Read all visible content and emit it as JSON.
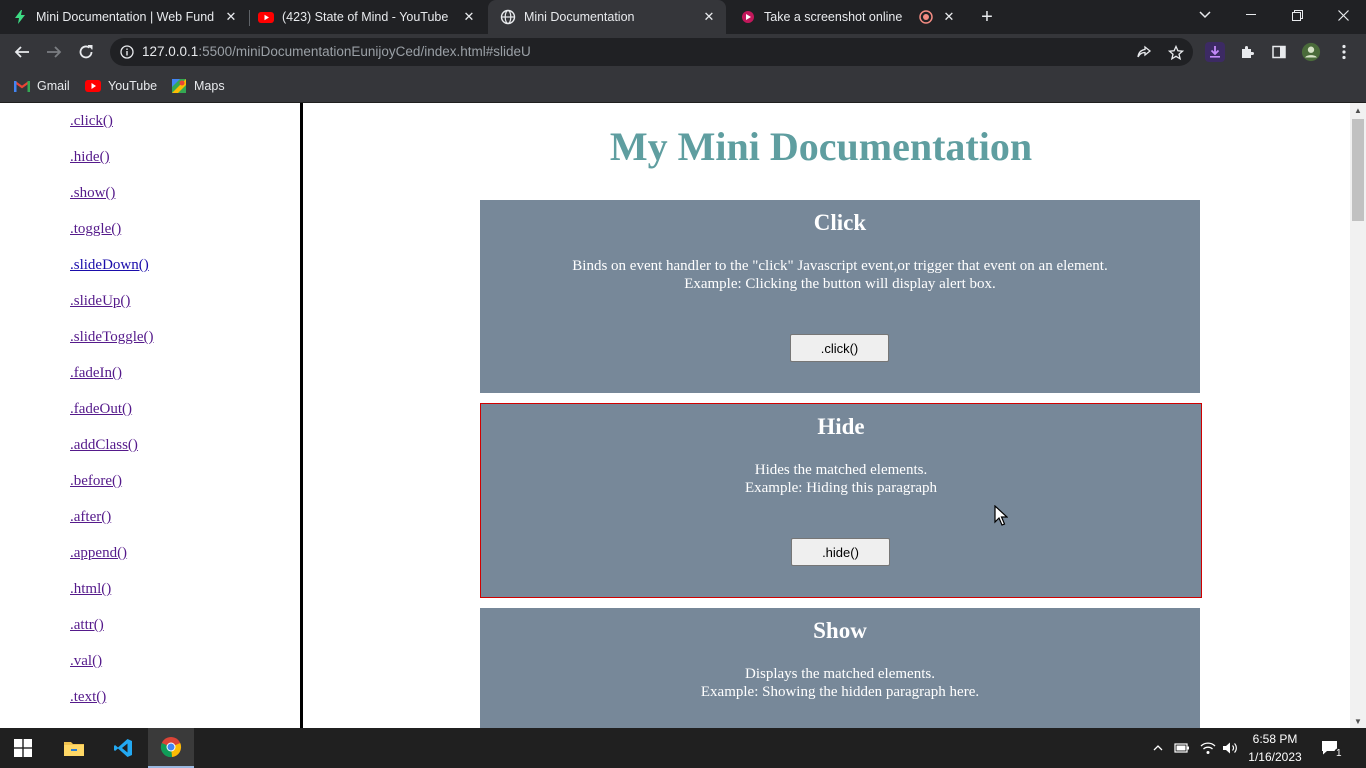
{
  "browser": {
    "tabs": [
      {
        "title": "Mini Documentation | Web Fund",
        "icon": "bolt-icon",
        "active": false
      },
      {
        "title": "(423) State of Mind - YouTube",
        "icon": "youtube-icon",
        "active": false
      },
      {
        "title": "Mini Documentation",
        "icon": "globe-icon",
        "active": true
      },
      {
        "title": "Take a screenshot online",
        "icon": "screenshot-site-icon",
        "active": false
      }
    ],
    "url_host": "127.0.0.1",
    "url_rest": ":5500/miniDocumentationEunijoyCed/index.html#slideU",
    "bookmarks": [
      {
        "label": "Gmail",
        "icon": "gmail-icon"
      },
      {
        "label": "YouTube",
        "icon": "youtube-icon"
      },
      {
        "label": "Maps",
        "icon": "maps-icon"
      }
    ]
  },
  "sidebar": {
    "links": [
      ".click()",
      ".hide()",
      ".show()",
      ".toggle()",
      ".slideDown()",
      ".slideUp()",
      ".slideToggle()",
      ".fadeIn()",
      ".fadeOut()",
      ".addClass()",
      ".before()",
      ".after()",
      ".append()",
      ".html()",
      ".attr()",
      ".val()",
      ".text()"
    ]
  },
  "main": {
    "title": "My Mini Documentation",
    "cards": [
      {
        "heading": "Click",
        "line1": "Binds on event handler to the \"click\" Javascript event,or trigger that event on an element.",
        "line2": "Example: Clicking the button will display alert box.",
        "button": ".click()"
      },
      {
        "heading": "Hide",
        "line1": "Hides the matched elements.",
        "line2": "Example: Hiding this paragraph",
        "button": ".hide()"
      },
      {
        "heading": "Show",
        "line1": "Displays the matched elements.",
        "line2": "Example: Showing the hidden paragraph here.",
        "button": ""
      }
    ]
  },
  "taskbar": {
    "apps": [
      "windows-start-icon",
      "file-explorer-icon",
      "vscode-icon",
      "chrome-icon"
    ],
    "time": "6:58 PM",
    "date": "1/16/2023",
    "notification_count": "1"
  },
  "colors": {
    "title": "#5f9ea0",
    "card_bg": "#778899",
    "card_outline": "#d00000",
    "sidebar_link": "#1a0dab"
  }
}
